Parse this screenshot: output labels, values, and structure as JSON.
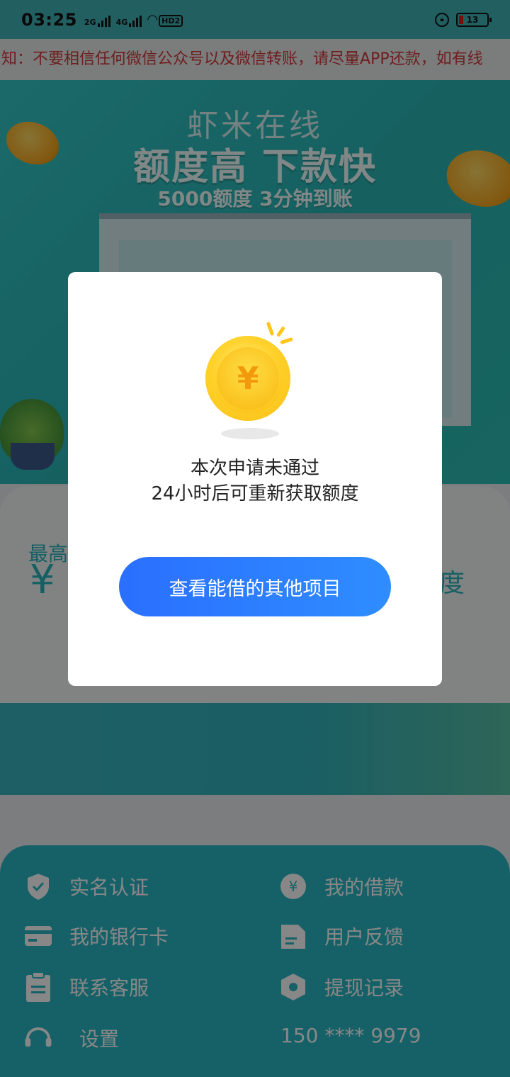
{
  "status_bar": {
    "time": "03:25",
    "net1": "2G",
    "net2": "4G",
    "hd_label": "HD2",
    "battery": "13"
  },
  "notice": {
    "text": "知：不要相信任何微信公众号以及微信转账，请尽量APP还款，如有线"
  },
  "banner": {
    "title": "虾米在线",
    "slogan": "额度高  下款快",
    "subtitle": "5000额度  3分钟到账"
  },
  "amount_card": {
    "label_partial": "最高",
    "currency": "¥",
    "tail": "度"
  },
  "menu": {
    "items": [
      {
        "label": "实名认证",
        "icon": "shield-check-icon"
      },
      {
        "label": "我的借款",
        "icon": "yen-circle-icon"
      },
      {
        "label": "我的银行卡",
        "icon": "bank-card-icon"
      },
      {
        "label": "用户反馈",
        "icon": "feedback-edit-icon"
      },
      {
        "label": "联系客服",
        "icon": "clipboard-icon"
      },
      {
        "label": "提现记录",
        "icon": "hexagon-record-icon"
      },
      {
        "label": "设置",
        "icon": "headset-settings-icon"
      }
    ],
    "phone": "150 **** 9979"
  },
  "dialog": {
    "coin_symbol": "¥",
    "message_line1": "本次申请未通过",
    "message_line2": "24小时后可重新获取额度",
    "button_label": "查看能借的其他项目"
  },
  "colors": {
    "accent": "#2ab7c4",
    "button": "#2a7bff",
    "notice_text": "#d03a3a"
  }
}
